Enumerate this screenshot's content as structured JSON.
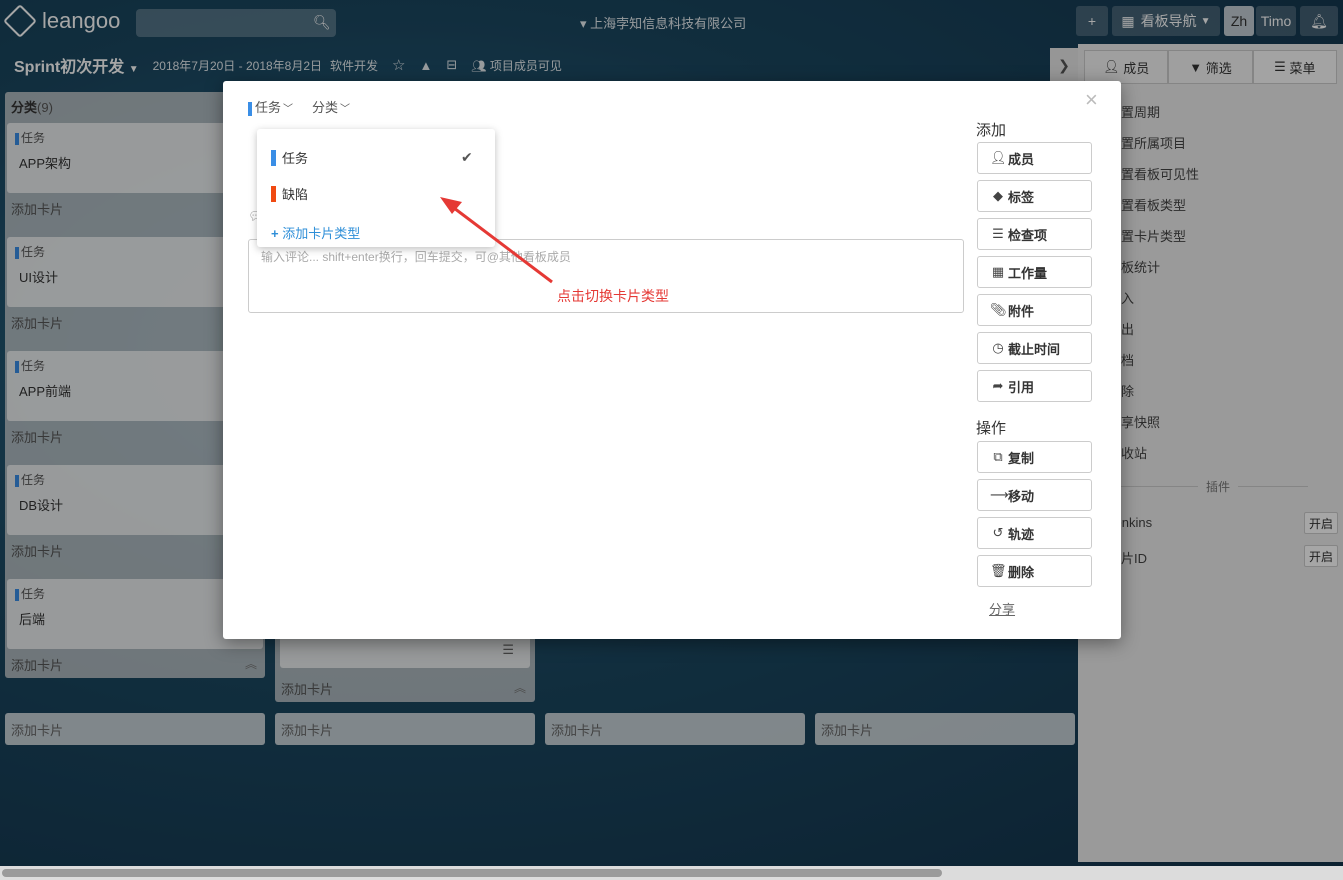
{
  "topbar": {
    "logo": "leangoo",
    "search_placeholder": "",
    "company": "上海孛知信息科技有限公司",
    "plus": "+",
    "board_nav": "看板导航",
    "lang": "Zh",
    "user": "Timo",
    "bell": "🔔"
  },
  "subbar": {
    "board_title": "Sprint初次开发",
    "date_range": "2018年7月20日 - 2018年8月2日",
    "project": "软件开发",
    "visibility": "项目成员可见"
  },
  "lists": [
    {
      "header": "分类",
      "count": "(9)",
      "cards": [
        {
          "type": "任务",
          "title": "APP架构"
        },
        {
          "type": "任务",
          "title": "UI设计"
        },
        {
          "type": "任务",
          "title": "APP前端"
        },
        {
          "type": "任务",
          "title": "DB设计"
        },
        {
          "type": "任务",
          "title": "后端"
        }
      ],
      "add_card": "添加卡片"
    }
  ],
  "bottom_add": [
    "添加卡片",
    "添加卡片",
    "添加卡片",
    "添加卡片"
  ],
  "side": {
    "tabs": [
      "成员",
      "筛选",
      "菜单"
    ],
    "items": [
      "设置周期",
      "设置所属项目",
      "设置看板可见性",
      "设置看板类型",
      "设置卡片类型",
      "看板统计",
      "导入",
      "导出",
      "归档",
      "删除",
      "分享快照",
      "回收站"
    ],
    "plugins_title": "插件",
    "plugins": [
      {
        "name": "Jenkins",
        "toggle": "开启"
      },
      {
        "name": "卡片ID",
        "toggle": "开启"
      }
    ]
  },
  "modal": {
    "close": "×",
    "type_label": "任务",
    "category_label": "分类",
    "comment_placeholder": "输入评论... shift+enter换行，回车提交，可@其他看板成员",
    "add_title": "添加",
    "add_buttons": [
      {
        "icon": "add-member-icon",
        "glyph": "👤",
        "label": "成员"
      },
      {
        "icon": "tag-icon",
        "glyph": "🏷",
        "label": "标签"
      },
      {
        "icon": "checklist-icon",
        "glyph": "☰",
        "label": "检查项"
      },
      {
        "icon": "workload-icon",
        "glyph": "▦",
        "label": "工作量"
      },
      {
        "icon": "attachment-icon",
        "glyph": "📎",
        "label": "附件"
      },
      {
        "icon": "clock-icon",
        "glyph": "⏱",
        "label": "截止时间"
      },
      {
        "icon": "share-arrow-icon",
        "glyph": "➦",
        "label": "引用"
      }
    ],
    "ops_title": "操作",
    "op_buttons": [
      {
        "icon": "copy-icon",
        "glyph": "⧉",
        "label": "复制"
      },
      {
        "icon": "move-icon",
        "glyph": "⟶",
        "label": "移动"
      },
      {
        "icon": "history-icon",
        "glyph": "↺",
        "label": "轨迹"
      },
      {
        "icon": "trash-icon",
        "glyph": "🗑",
        "label": "删除"
      }
    ],
    "share": "分享"
  },
  "dropdown": {
    "items": [
      {
        "label": "任务",
        "color": "#3a8ee6",
        "checked": true
      },
      {
        "label": "缺陷",
        "color": "#f04a12",
        "checked": false
      }
    ],
    "add_type": "添加卡片类型"
  },
  "annotation": "点击切换卡片类型"
}
